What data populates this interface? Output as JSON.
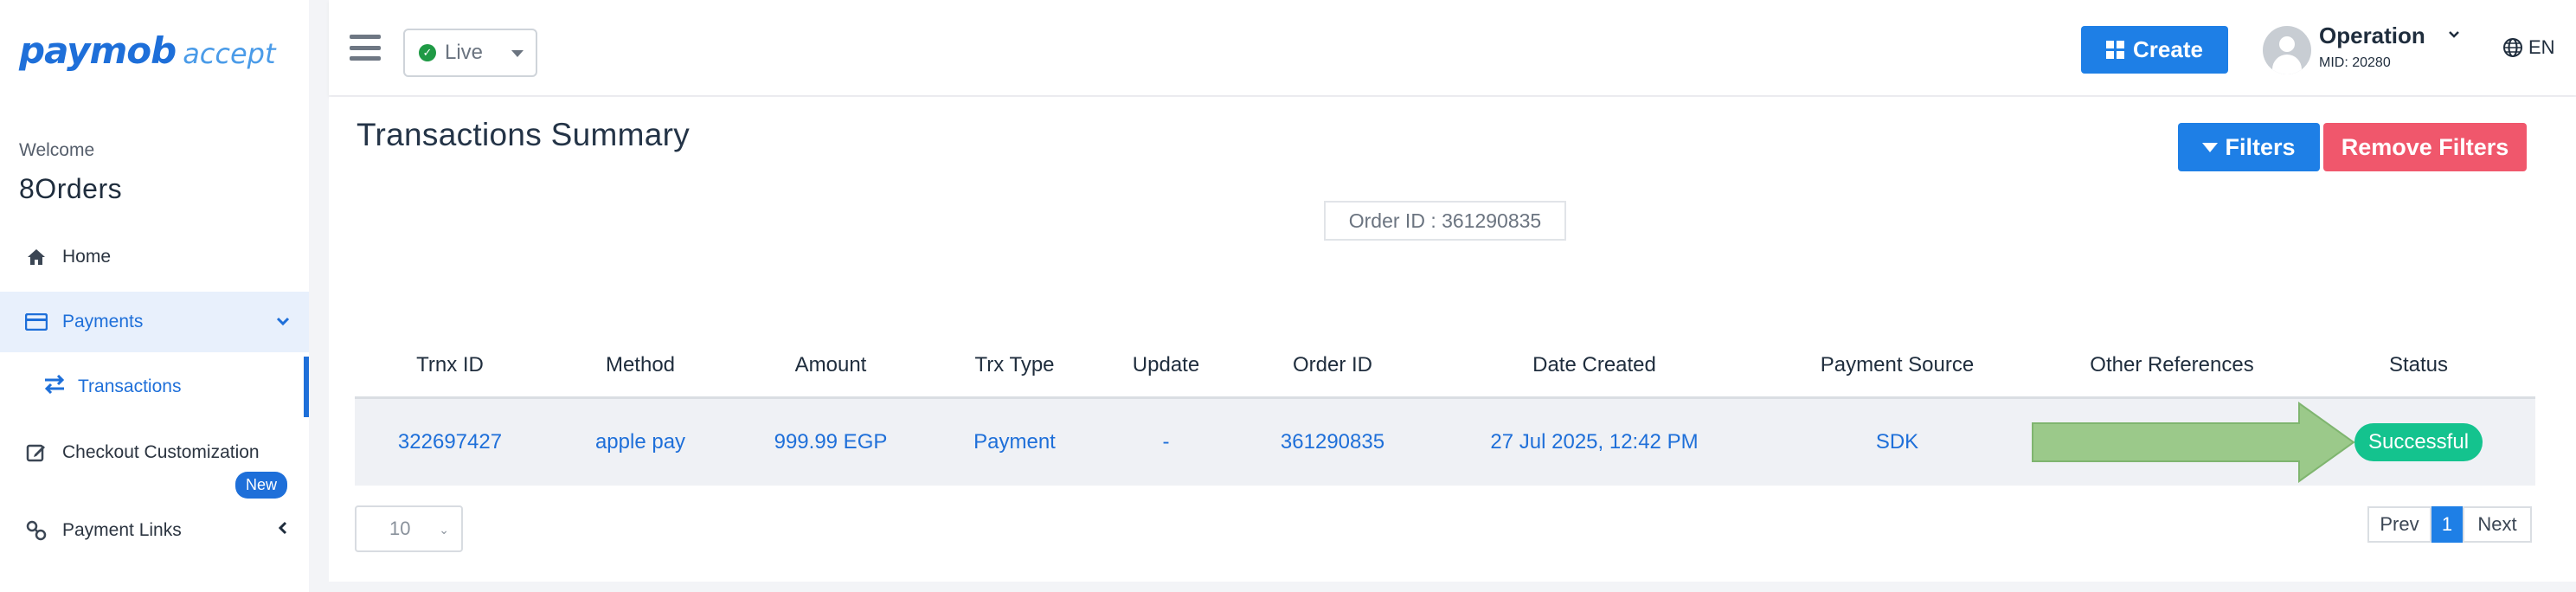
{
  "brand": {
    "logo_main": "paymob",
    "logo_sub": "accept"
  },
  "sidebar": {
    "welcome": "Welcome",
    "merchant_name": "8Orders",
    "items": [
      {
        "label": "Home",
        "icon": "home-icon"
      },
      {
        "label": "Payments",
        "icon": "credit-card-icon",
        "expanded": true
      },
      {
        "label": "Transactions",
        "icon": "swap-arrows-icon",
        "sub": true,
        "active": true
      },
      {
        "label": "Checkout Customization",
        "icon": "edit-icon",
        "badge": "New"
      },
      {
        "label": "Payment Links",
        "icon": "link-icon"
      }
    ]
  },
  "topbar": {
    "mode_value": "Live",
    "create_label": "Create",
    "user_name": "Operation",
    "user_mid": "MID: 20280",
    "language": "EN"
  },
  "main": {
    "title": "Transactions Summary",
    "filters_label": "Filters",
    "remove_filters_label": "Remove Filters",
    "order_filter_chip": "Order ID : 361290835",
    "table": {
      "headers": [
        "Trnx ID",
        "Method",
        "Amount",
        "Trx Type",
        "Update",
        "Order ID",
        "Date Created",
        "Payment Source",
        "Other References",
        "Status"
      ],
      "rows": [
        [
          "322697427",
          "apple pay",
          "999.99 EGP",
          "Payment",
          "-",
          "361290835",
          "27 Jul 2025, 12:42 PM",
          "SDK",
          "",
          "Successful"
        ]
      ]
    },
    "page_size": "10",
    "pagination": {
      "prev": "Prev",
      "current": "1",
      "next": "Next"
    }
  },
  "colors": {
    "primary": "#1e7fe6",
    "danger": "#f0576c",
    "success": "#14c38e",
    "annotation_arrow": "#9bc98a"
  }
}
